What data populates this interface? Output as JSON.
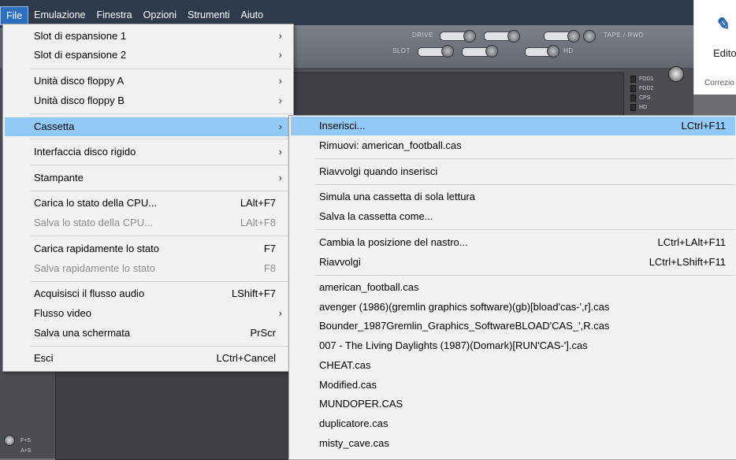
{
  "menubar": {
    "items": [
      "File",
      "Emulazione",
      "Finestra",
      "Opzioni",
      "Strumenti",
      "Aiuto"
    ],
    "active": "File"
  },
  "panel": {
    "drive_label": "DRIVE",
    "slot_label": "SLOT",
    "tape_label": "TAPE / RWD",
    "hd_label": "HD",
    "leds": [
      "FDD1",
      "FDD2",
      "CPS",
      "HD"
    ],
    "bottom_labels": [
      "F+S",
      "A+S"
    ]
  },
  "ribbon": {
    "icon": "editor-icon",
    "editor_label": "Edito",
    "corr_label": "Correzio"
  },
  "file_menu": {
    "items": [
      {
        "label": "Slot di espansione 1",
        "submenu": true
      },
      {
        "label": "Slot di espansione 2",
        "submenu": true
      },
      {
        "label": "Unità disco floppy A",
        "submenu": true
      },
      {
        "label": "Unità disco floppy B",
        "submenu": true
      },
      {
        "label": "Cassetta",
        "submenu": true
      },
      {
        "label": "Interfaccia disco rigido",
        "submenu": true
      },
      {
        "label": "Stampante",
        "submenu": true
      },
      {
        "label": "Carica lo stato della CPU...",
        "shortcut": "LAlt+F7"
      },
      {
        "label": "Salva lo stato della CPU...",
        "shortcut": "LAlt+F8",
        "disabled": true
      },
      {
        "label": "Carica rapidamente lo stato",
        "shortcut": "F7"
      },
      {
        "label": "Salva rapidamente lo stato",
        "shortcut": "F8",
        "disabled": true
      },
      {
        "label": "Acquisisci il flusso audio",
        "shortcut": "LShift+F7"
      },
      {
        "label": "Flusso video",
        "submenu": true
      },
      {
        "label": "Salva una schermata",
        "shortcut": "PrScr"
      },
      {
        "label": "Esci",
        "shortcut": "LCtrl+Cancel"
      }
    ]
  },
  "cassette_menu": {
    "items": [
      {
        "label": "Inserisci...",
        "shortcut": "LCtrl+F11"
      },
      {
        "label": "Rimuovi: american_football.cas"
      },
      {
        "label": "Riavvolgi quando inserisci"
      },
      {
        "label": "Simula una cassetta di sola lettura"
      },
      {
        "label": "Salva la cassetta come..."
      },
      {
        "label": "Cambia la posizione del nastro...",
        "shortcut": "LCtrl+LAlt+F11"
      },
      {
        "label": "Riavvolgi",
        "shortcut": "LCtrl+LShift+F11"
      },
      {
        "label": "american_football.cas"
      },
      {
        "label": "avenger (1986)(gremlin graphics software)(gb)[bload'cas-',r].cas"
      },
      {
        "label": "Bounder_1987Gremlin_Graphics_SoftwareBLOAD'CAS_',R.cas"
      },
      {
        "label": "007 - The Living Daylights (1987)(Domark)[RUN'CAS-'].cas"
      },
      {
        "label": "CHEAT.cas"
      },
      {
        "label": "Modified.cas"
      },
      {
        "label": "MUNDOPER.CAS"
      },
      {
        "label": "duplicatore.cas"
      },
      {
        "label": "misty_cave.cas"
      }
    ]
  }
}
